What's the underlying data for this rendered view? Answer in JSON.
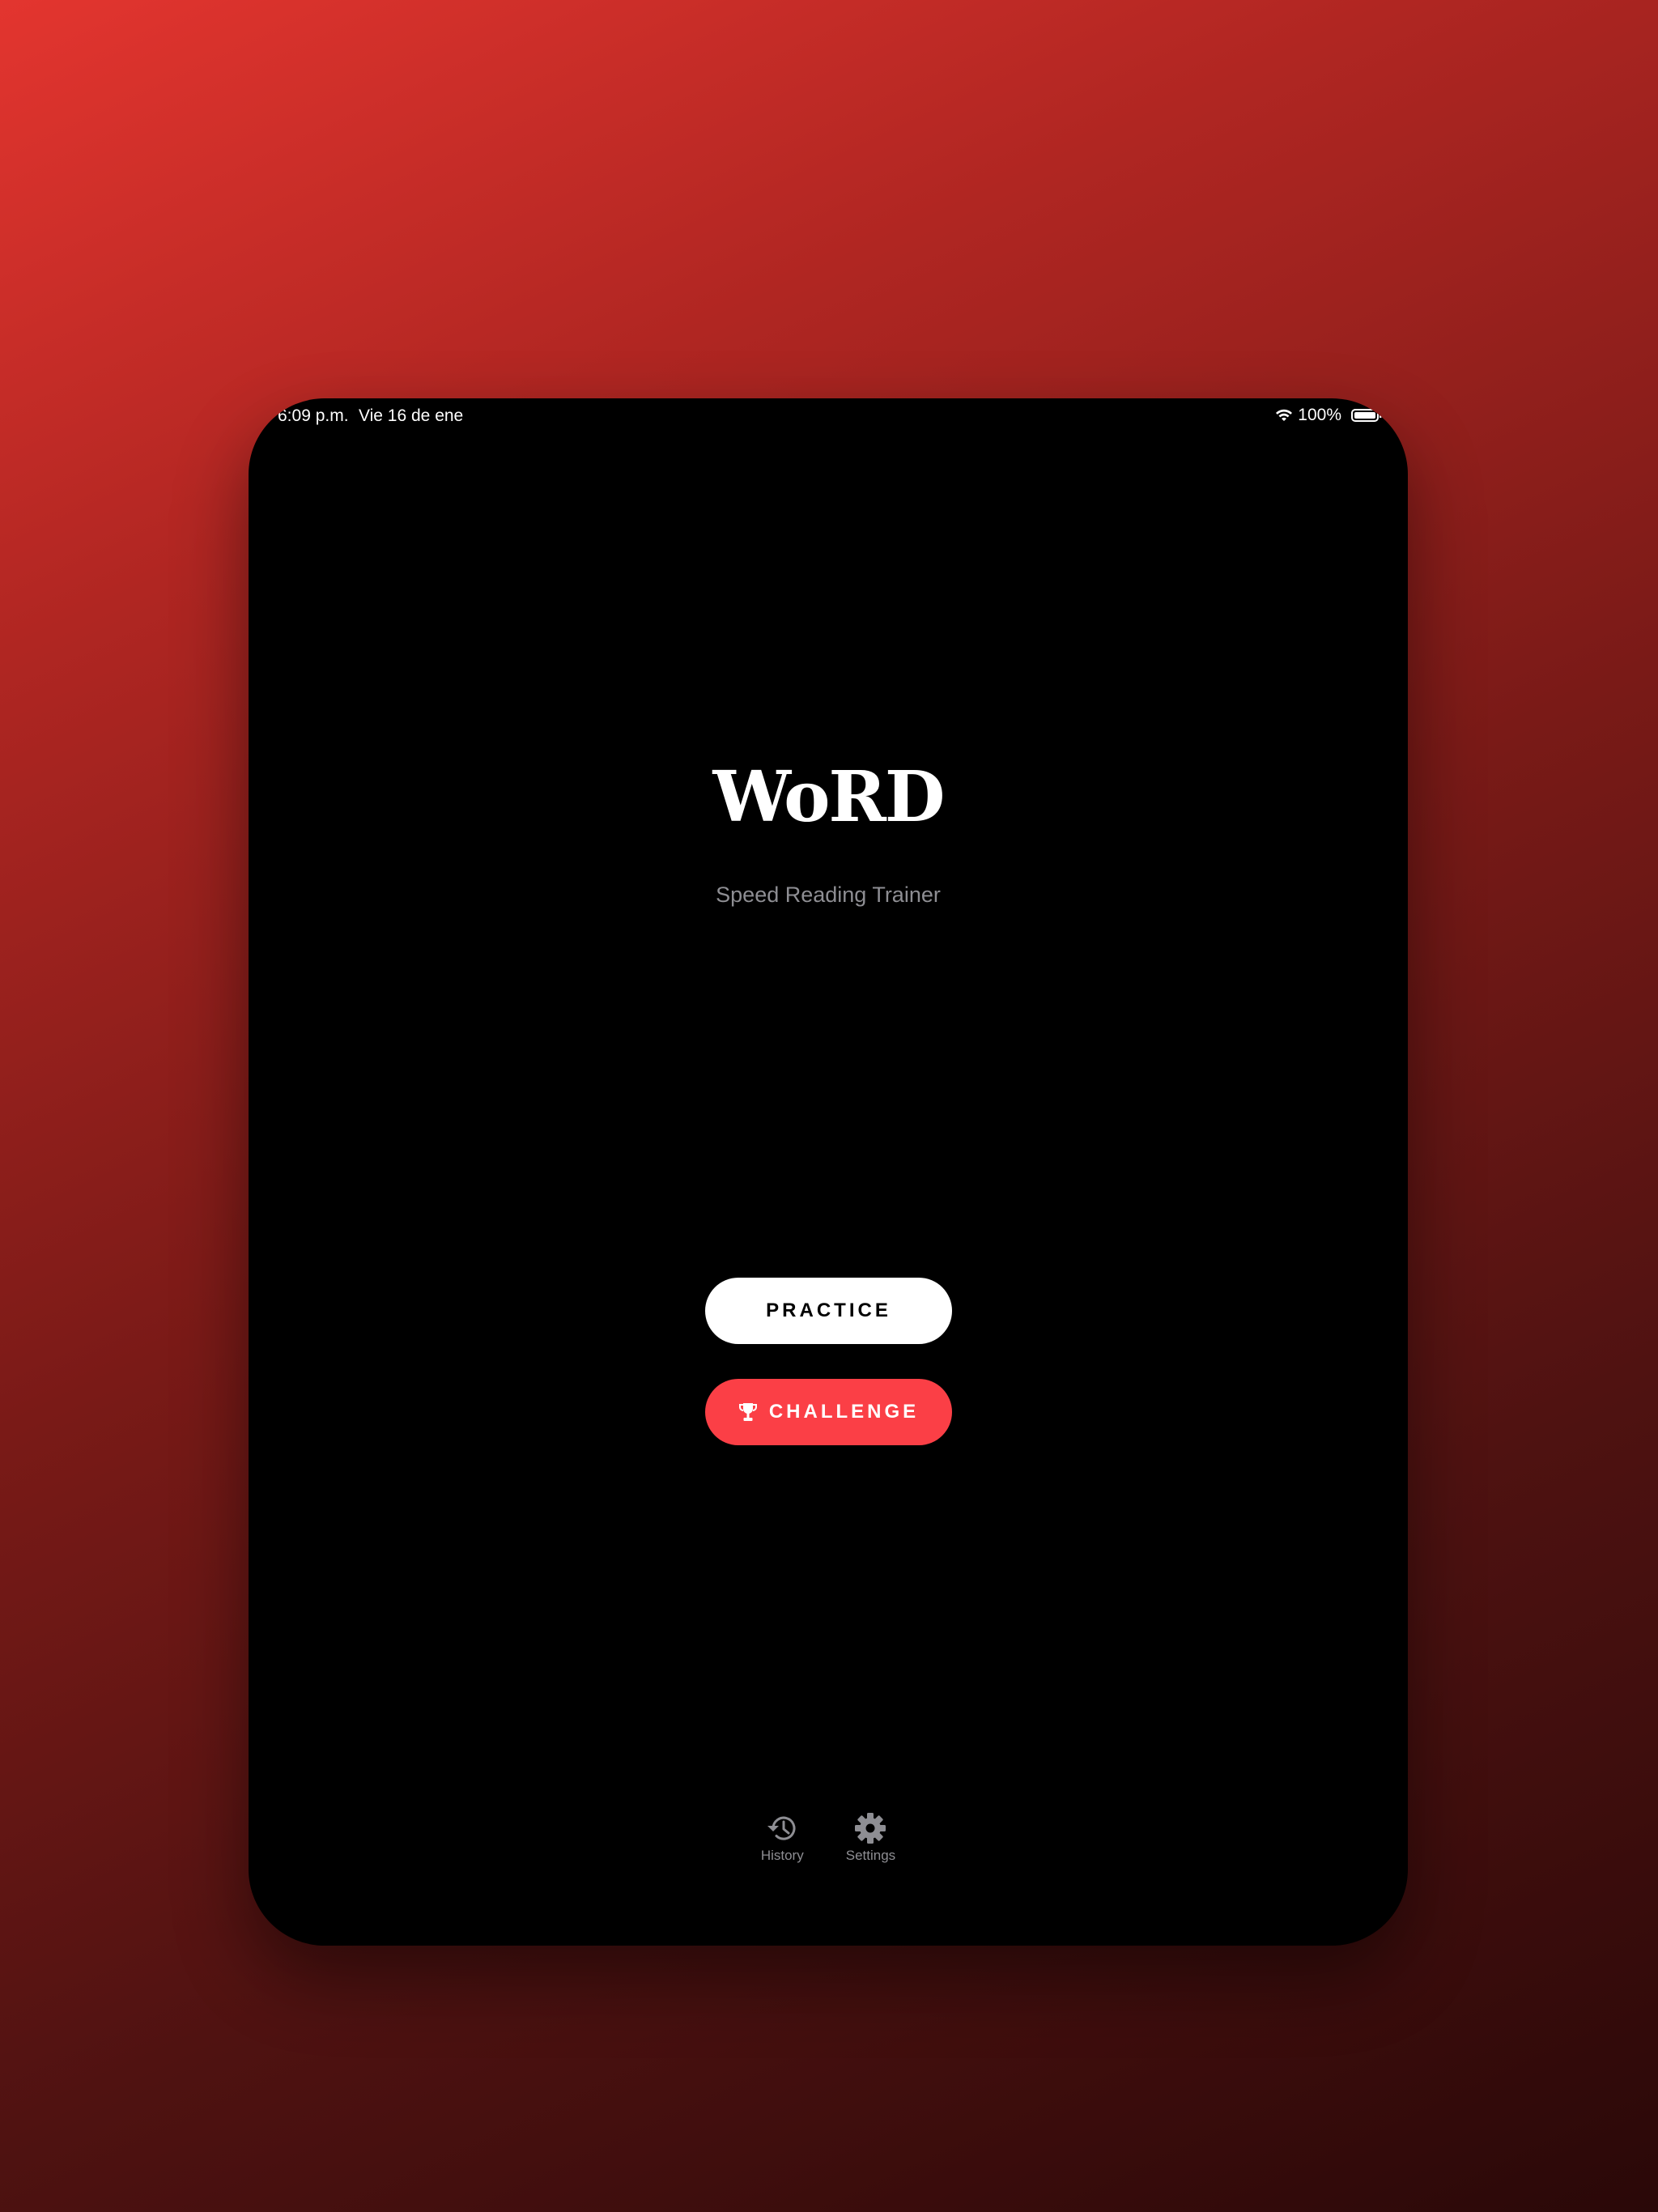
{
  "status_bar": {
    "time": "6:09 p.m.",
    "date": "Vie 16 de ene",
    "battery": "100%",
    "icons": [
      "wifi-icon",
      "battery-icon"
    ]
  },
  "app": {
    "title": "WoRD",
    "subtitle": "Speed Reading Trainer"
  },
  "buttons": {
    "practice": "PRACTICE",
    "challenge": "CHALLENGE",
    "challenge_icon": "trophy-icon"
  },
  "tabs": [
    {
      "label": "History",
      "icon": "history-icon"
    },
    {
      "label": "Settings",
      "icon": "gear-icon"
    }
  ],
  "colors": {
    "accent": "#fb3f46",
    "background": "#000000",
    "muted_text": "#8e8e93",
    "wallpaper_top": "#e3352f",
    "wallpaper_bottom": "#2a0808"
  }
}
